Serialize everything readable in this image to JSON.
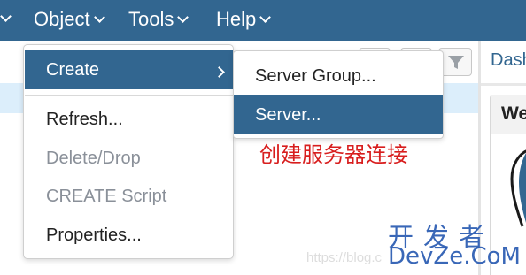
{
  "menubar": {
    "items": [
      {
        "label": "Object"
      },
      {
        "label": "Tools"
      },
      {
        "label": "Help"
      }
    ]
  },
  "dropdown": {
    "create_label": "Create",
    "items": [
      {
        "label": "Refresh...",
        "enabled": true
      },
      {
        "label": "Delete/Drop",
        "enabled": false
      },
      {
        "label": "CREATE Script",
        "enabled": false
      },
      {
        "label": "Properties...",
        "enabled": true
      }
    ]
  },
  "submenu": {
    "items": [
      {
        "label": "Server Group...",
        "selected": false
      },
      {
        "label": "Server...",
        "selected": true
      }
    ]
  },
  "right_panel": {
    "tab_label": "Dash",
    "card_title": "We"
  },
  "annotation": {
    "text": "创建服务器连接"
  },
  "watermark": {
    "url": "https://blog.c",
    "brand_cn": "开发者",
    "brand_en": "DevZe.CoM"
  },
  "colors": {
    "menubar": "#326690",
    "highlight": "#326690",
    "annotation": "#d81e1e",
    "watermark": "#2f5fb4"
  }
}
